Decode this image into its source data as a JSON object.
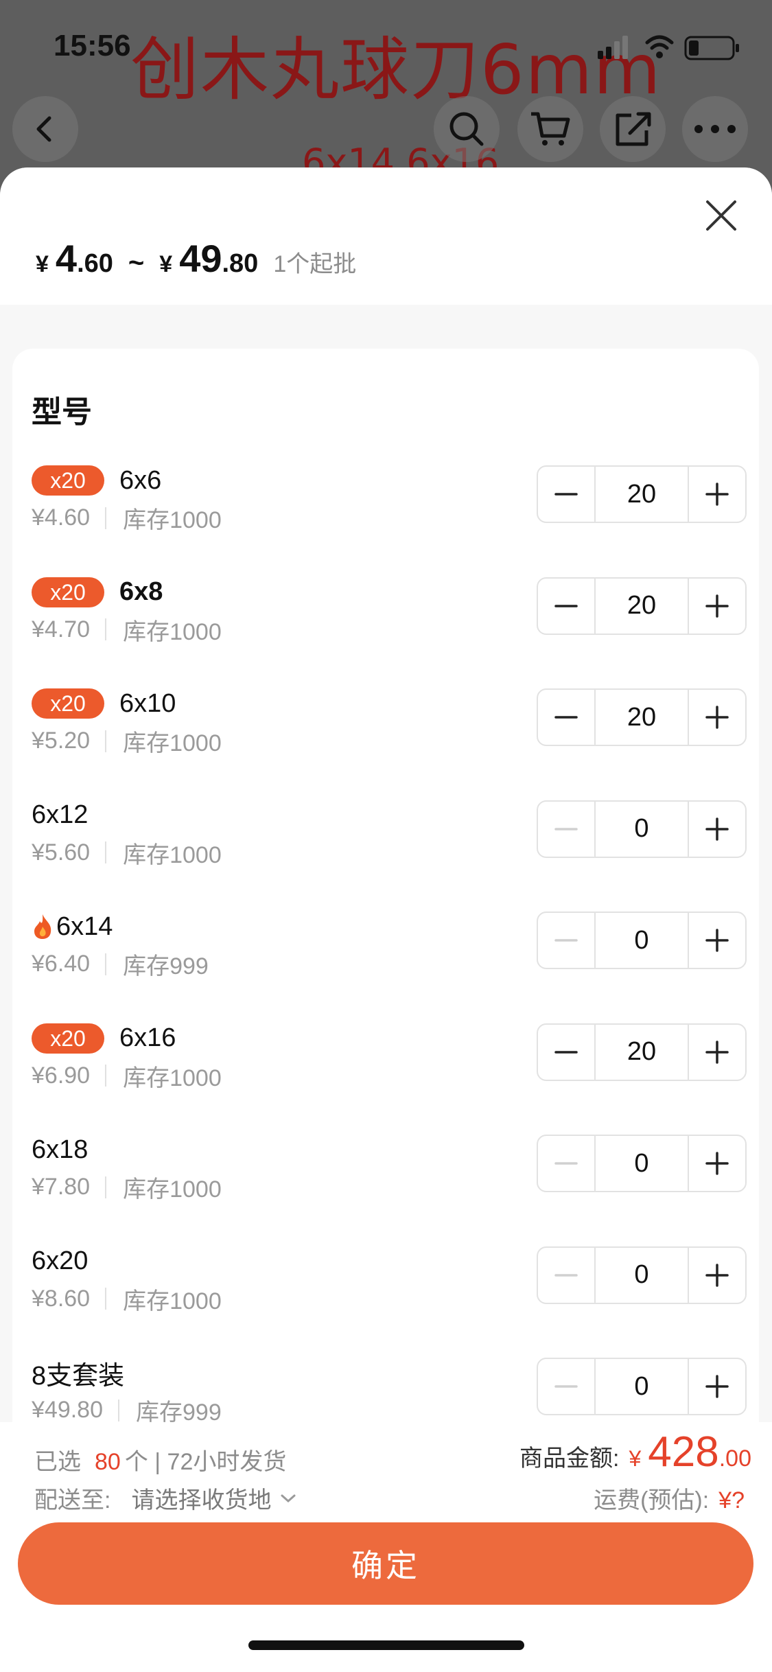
{
  "status": {
    "time": "15:56"
  },
  "background": {
    "title": "创木丸球刀6mm",
    "subtitle": "6x14 6x16"
  },
  "header": {
    "currency": "¥",
    "price_min_int": "4",
    "price_min_dec": ".60",
    "tilde": "~",
    "price_max_int": "49",
    "price_max_dec": ".80",
    "moq": "1个起批"
  },
  "section": {
    "title": "型号"
  },
  "stock_prefix": "库存",
  "items": [
    {
      "badge": "x20",
      "name": "6x6",
      "price": "¥4.60",
      "stock": "库存1000",
      "qty": "20"
    },
    {
      "badge": "x20",
      "name": "6x8",
      "price": "¥4.70",
      "stock": "库存1000",
      "qty": "20"
    },
    {
      "badge": "x20",
      "name": "6x10",
      "price": "¥5.20",
      "stock": "库存1000",
      "qty": "20"
    },
    {
      "badge": "",
      "name": "6x12",
      "price": "¥5.60",
      "stock": "库存1000",
      "qty": "0"
    },
    {
      "badge": "",
      "name": "6x14",
      "price": "¥6.40",
      "stock": "库存999",
      "qty": "0",
      "hot": true
    },
    {
      "badge": "x20",
      "name": "6x16",
      "price": "¥6.90",
      "stock": "库存1000",
      "qty": "20"
    },
    {
      "badge": "",
      "name": "6x18",
      "price": "¥7.80",
      "stock": "库存1000",
      "qty": "0"
    },
    {
      "badge": "",
      "name": "6x20",
      "price": "¥8.60",
      "stock": "库存1000",
      "qty": "0"
    },
    {
      "badge": "",
      "name": "8支套装",
      "price": "¥49.80",
      "stock": "库存999",
      "qty": "0"
    }
  ],
  "footer": {
    "selected_prefix": "已选",
    "selected_count": "80",
    "selected_suffix": "个 | 72小时发货",
    "ship_label": "配送至:",
    "ship_value": "请选择收货地",
    "amount_label": "商品金额:",
    "amount_currency": "¥",
    "amount_int": "428",
    "amount_dec": ".00",
    "fee_label": "运费(预估):",
    "fee_value": "¥?",
    "confirm_label": "确定"
  },
  "colors": {
    "accent": "#ED6A3D",
    "badge": "#EC5A2C",
    "price_red": "#E5422A"
  }
}
